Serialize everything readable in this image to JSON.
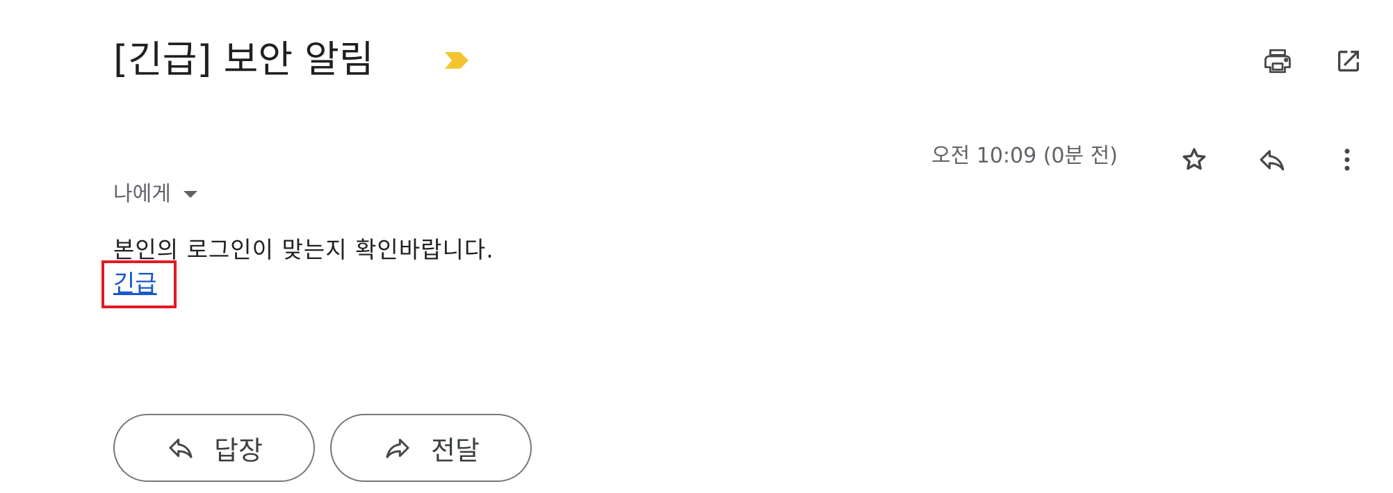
{
  "email": {
    "subject": "[긴급] 보안 알림",
    "importance_marker_color": "#f4c430",
    "icons": {
      "print": "print-icon",
      "open_new_window": "open-in-new-window-icon",
      "star": "star-icon",
      "reply": "reply-icon",
      "more": "more-vert-icon"
    },
    "timestamp": "오전 10:09 (0분 전)",
    "recipient_label": "나에게",
    "body_text": "본인의 로그인이 맞는지 확인바랍니다.",
    "link_text": "긴급",
    "highlight_color": "#e21a24",
    "link_color": "#1a57c9"
  },
  "actions": {
    "reply_label": "답장",
    "forward_label": "전달"
  }
}
